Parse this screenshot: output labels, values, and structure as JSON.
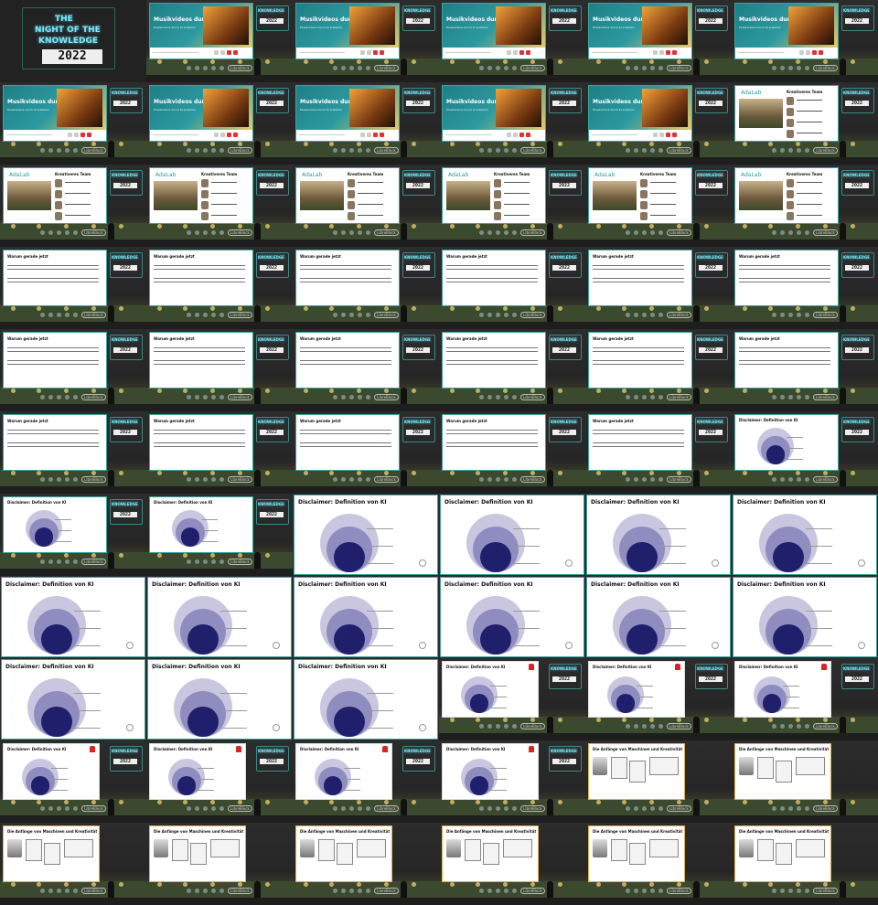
{
  "grid": {
    "columns": 6,
    "rows": 11
  },
  "neon_logo": {
    "the": "THE",
    "line1": "NIGHT OF THE",
    "line2": "KNOWLEDGE",
    "year": "2022"
  },
  "footer": {
    "brand": "LibreBlock"
  },
  "texts": {
    "musikvideos_title": "Musikvideos durch KI",
    "musikvideos_sub": "Musikvideos durch KI erstellen",
    "kreativ_title": "Kreativeres Team",
    "adalab": "AdaLab",
    "warum_title": "Warum gerade jetzt",
    "disclaimer_title": "Disclaimer: Definition von KI",
    "anfaenge_title": "Die Anfänge von Maschinen und Kreativität"
  },
  "colors": {
    "background": "#1c1c1c",
    "teal": "#2b9aa0",
    "amber": "#e0b04a",
    "neon": "#7ee6f0",
    "circle_outer": "#c9c7e0",
    "circle_mid": "#8f8cc0",
    "circle_inner": "#1f1f6b",
    "siren": "#dd2222"
  },
  "cells": [
    {
      "type": "title"
    },
    {
      "type": "musik"
    },
    {
      "type": "musik"
    },
    {
      "type": "musik"
    },
    {
      "type": "musik"
    },
    {
      "type": "musik"
    },
    {
      "type": "musik"
    },
    {
      "type": "musik"
    },
    {
      "type": "musik"
    },
    {
      "type": "musik"
    },
    {
      "type": "musik"
    },
    {
      "type": "team"
    },
    {
      "type": "team"
    },
    {
      "type": "team"
    },
    {
      "type": "team"
    },
    {
      "type": "team"
    },
    {
      "type": "team"
    },
    {
      "type": "team"
    },
    {
      "type": "warum"
    },
    {
      "type": "warum"
    },
    {
      "type": "warum"
    },
    {
      "type": "warum"
    },
    {
      "type": "warum"
    },
    {
      "type": "warum"
    },
    {
      "type": "warum"
    },
    {
      "type": "warum"
    },
    {
      "type": "warum"
    },
    {
      "type": "warum"
    },
    {
      "type": "warum"
    },
    {
      "type": "warum"
    },
    {
      "type": "warum"
    },
    {
      "type": "warum"
    },
    {
      "type": "warum"
    },
    {
      "type": "warum"
    },
    {
      "type": "warum"
    },
    {
      "type": "disclaimer"
    },
    {
      "type": "disclaimer"
    },
    {
      "type": "disclaimer"
    },
    {
      "type": "disclaimer_full"
    },
    {
      "type": "disclaimer_full"
    },
    {
      "type": "disclaimer_full"
    },
    {
      "type": "disclaimer_full"
    },
    {
      "type": "disclaimer_full"
    },
    {
      "type": "disclaimer_full"
    },
    {
      "type": "disclaimer_full"
    },
    {
      "type": "disclaimer_full"
    },
    {
      "type": "disclaimer_full"
    },
    {
      "type": "disclaimer_full"
    },
    {
      "type": "disclaimer_full"
    },
    {
      "type": "disclaimer_full"
    },
    {
      "type": "disclaimer_full"
    },
    {
      "type": "disclaimer_siren"
    },
    {
      "type": "disclaimer_siren"
    },
    {
      "type": "disclaimer_siren"
    },
    {
      "type": "disclaimer_siren"
    },
    {
      "type": "disclaimer_siren"
    },
    {
      "type": "disclaimer_siren"
    },
    {
      "type": "disclaimer_siren"
    },
    {
      "type": "anfaenge"
    },
    {
      "type": "anfaenge"
    },
    {
      "type": "anfaenge"
    },
    {
      "type": "anfaenge"
    },
    {
      "type": "anfaenge"
    },
    {
      "type": "anfaenge"
    },
    {
      "type": "anfaenge"
    },
    {
      "type": "anfaenge"
    }
  ]
}
